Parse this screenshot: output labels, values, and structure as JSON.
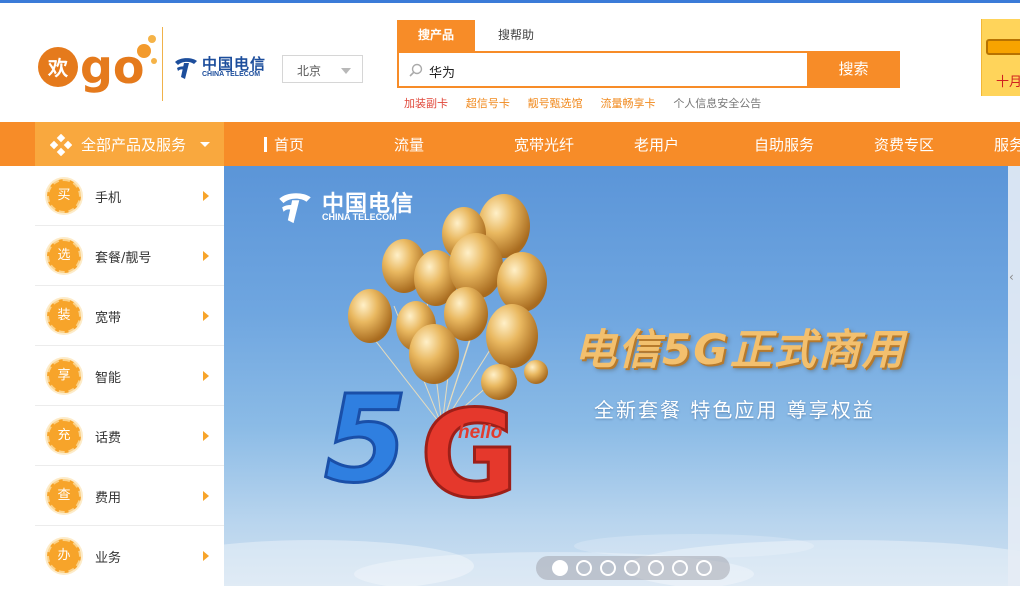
{
  "header": {
    "brand_logo_text": "欢go",
    "partner_logo_cn": "中国电信",
    "partner_logo_en": "CHINA TELECOM",
    "city": "北京",
    "search": {
      "tabs": [
        "搜产品",
        "搜帮助"
      ],
      "active_tab": "搜产品",
      "value": "华为",
      "button_label": "搜索"
    },
    "hot_links": [
      {
        "label": "加装副卡",
        "color": "#e0473a"
      },
      {
        "label": "超信号卡",
        "color": "#f0891d"
      },
      {
        "label": "靓号甄选馆",
        "color": "#f0891d"
      },
      {
        "label": "流量畅享卡",
        "color": "#f0891d"
      },
      {
        "label": "个人信息安全公告",
        "color": "#777777"
      }
    ],
    "promo_text": "十月"
  },
  "nav": {
    "all_products_label": "全部产品及服务",
    "items": [
      "首页",
      "流量",
      "宽带光纤",
      "老用户",
      "自助服务",
      "资费专区",
      "服务"
    ]
  },
  "side_menu": [
    {
      "badge": "买",
      "label": "手机"
    },
    {
      "badge": "选",
      "label": "套餐/靓号"
    },
    {
      "badge": "装",
      "label": "宽带"
    },
    {
      "badge": "享",
      "label": "智能"
    },
    {
      "badge": "充",
      "label": "话费"
    },
    {
      "badge": "查",
      "label": "费用"
    },
    {
      "badge": "办",
      "label": "业务"
    }
  ],
  "banner": {
    "logo_cn": "中国电信",
    "logo_en": "CHINA TELECOM",
    "headline": "电信5G正式商用",
    "subline": "全新套餐  特色应用  尊享权益",
    "art_text": "5G",
    "hello": "hello",
    "slide_count": 7,
    "active_slide": 1
  },
  "colors": {
    "brand_orange": "#f78c28",
    "nav_highlight": "#f9a83e",
    "telecom_blue": "#1d4e9c"
  }
}
